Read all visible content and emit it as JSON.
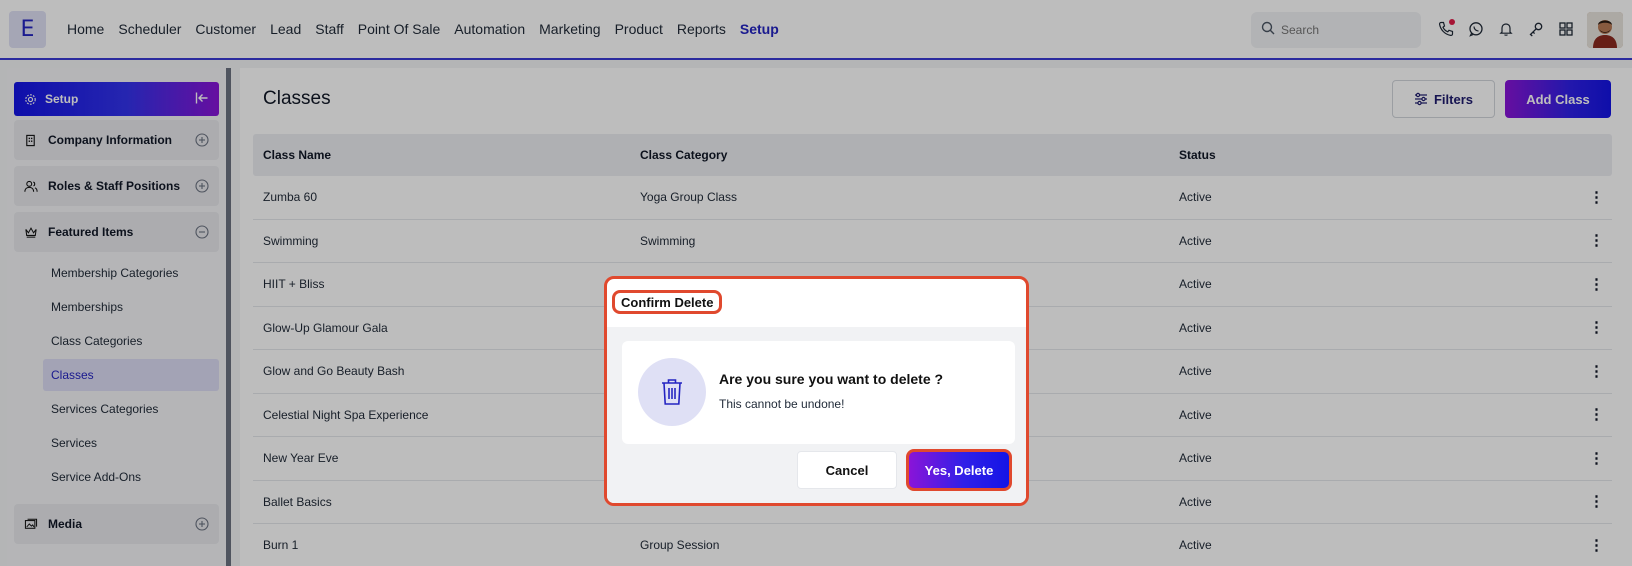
{
  "app": {
    "logo_letter": "E"
  },
  "nav": {
    "items": [
      {
        "label": "Home",
        "active": false
      },
      {
        "label": "Scheduler",
        "active": false
      },
      {
        "label": "Customer",
        "active": false
      },
      {
        "label": "Lead",
        "active": false
      },
      {
        "label": "Staff",
        "active": false
      },
      {
        "label": "Point Of Sale",
        "active": false
      },
      {
        "label": "Automation",
        "active": false
      },
      {
        "label": "Marketing",
        "active": false
      },
      {
        "label": "Product",
        "active": false
      },
      {
        "label": "Reports",
        "active": false
      },
      {
        "label": "Setup",
        "active": true
      }
    ],
    "search_placeholder": "Search",
    "icons": [
      "phone-icon",
      "whatsapp-icon",
      "bell-icon",
      "key-icon",
      "apps-grid-icon"
    ]
  },
  "sidebar": {
    "header": "Setup",
    "groups": {
      "company": "Company Information",
      "roles": "Roles & Staff Positions",
      "featured": "Featured Items",
      "media": "Media"
    },
    "sub_items": [
      {
        "label": "Membership Categories",
        "active": false
      },
      {
        "label": "Memberships",
        "active": false
      },
      {
        "label": "Class Categories",
        "active": false
      },
      {
        "label": "Classes",
        "active": true
      },
      {
        "label": "Services Categories",
        "active": false
      },
      {
        "label": "Services",
        "active": false
      },
      {
        "label": "Service Add-Ons",
        "active": false
      }
    ]
  },
  "main": {
    "title": "Classes",
    "filters_label": "Filters",
    "add_label": "Add Class",
    "columns": [
      "Class Name",
      "Class Category",
      "Status"
    ],
    "rows": [
      {
        "name": "Zumba 60",
        "category": "Yoga Group Class",
        "status": "Active"
      },
      {
        "name": "Swimming",
        "category": "Swimming",
        "status": "Active"
      },
      {
        "name": "HIIT + Bliss",
        "category": "",
        "status": "Active"
      },
      {
        "name": "Glow-Up Glamour Gala",
        "category": "",
        "status": "Active"
      },
      {
        "name": "Glow and Go Beauty Bash",
        "category": "",
        "status": "Active"
      },
      {
        "name": "Celestial Night Spa Experience",
        "category": "",
        "status": "Active"
      },
      {
        "name": "New Year Eve",
        "category": "",
        "status": "Active"
      },
      {
        "name": "Ballet Basics",
        "category": "",
        "status": "Active"
      },
      {
        "name": "Burn 1",
        "category": "Group Session",
        "status": "Active"
      }
    ]
  },
  "modal": {
    "title": "Confirm Delete",
    "question": "Are you sure you want to delete ?",
    "subtext": "This cannot be undone!",
    "cancel_label": "Cancel",
    "confirm_label": "Yes, Delete"
  },
  "colors": {
    "accent": "#2424c2",
    "gradient_start": "#1414e6",
    "gradient_end": "#8a14d8",
    "highlight": "#e0492e"
  }
}
